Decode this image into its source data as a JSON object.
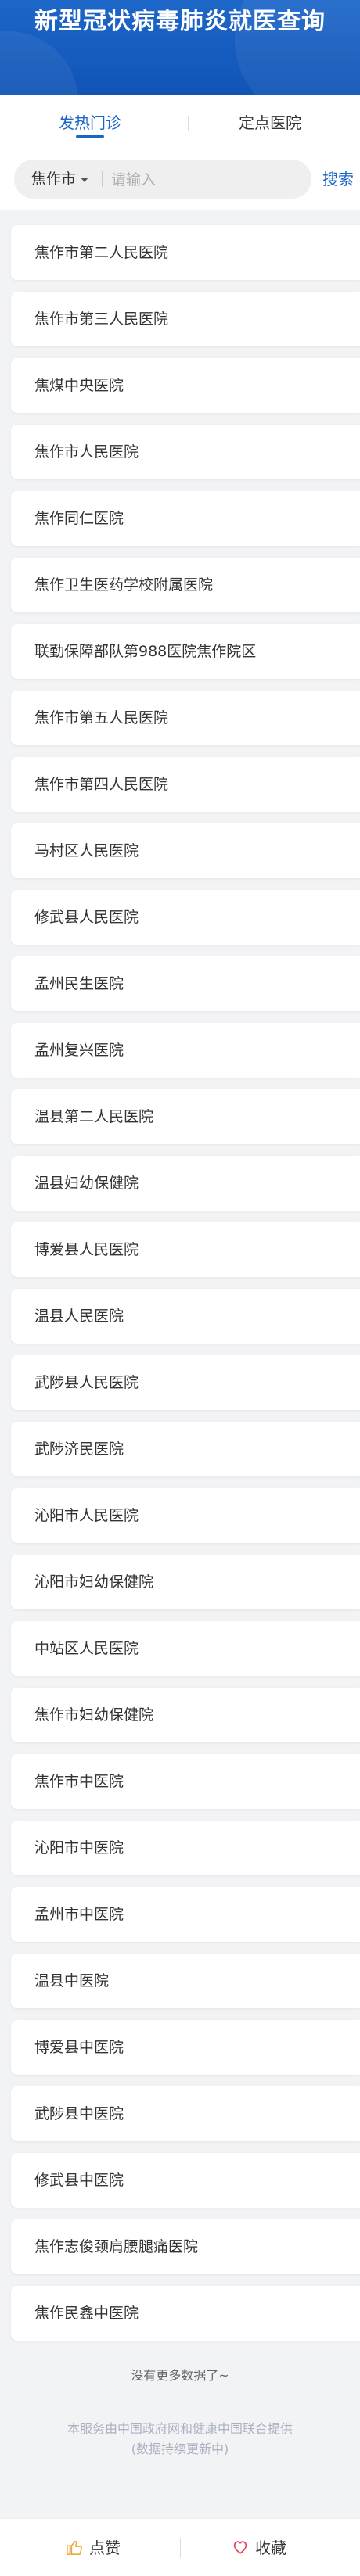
{
  "header": {
    "title": "新型冠状病毒肺炎就医查询"
  },
  "tabs": [
    {
      "label": "发热门诊",
      "active": true
    },
    {
      "label": "定点医院",
      "active": false
    }
  ],
  "search": {
    "city": "焦作市",
    "placeholder": "请输入",
    "value": "",
    "button_label": "搜索"
  },
  "hospitals": [
    "焦作市第二人民医院",
    "焦作市第三人民医院",
    "焦煤中央医院",
    "焦作市人民医院",
    "焦作同仁医院",
    "焦作卫生医药学校附属医院",
    "联勤保障部队第988医院焦作院区",
    "焦作市第五人民医院",
    "焦作市第四人民医院",
    "马村区人民医院",
    "修武县人民医院",
    "孟州民生医院",
    "孟州复兴医院",
    "温县第二人民医院",
    "温县妇幼保健院",
    "博爱县人民医院",
    "温县人民医院",
    "武陟县人民医院",
    "武陟济民医院",
    "沁阳市人民医院",
    "沁阳市妇幼保健院",
    "中站区人民医院",
    "焦作市妇幼保健院",
    "焦作市中医院",
    "沁阳市中医院",
    "孟州市中医院",
    "温县中医院",
    "博爱县中医院",
    "武陟县中医院",
    "修武县中医院",
    "焦作志俊颈肩腰腿痛医院",
    "焦作民鑫中医院"
  ],
  "footer": {
    "no_more": "没有更多数据了~",
    "notice_line1": "本服务由中国政府网和健康中国联合提供",
    "notice_line2": "(数据持续更新中)"
  },
  "bottom_bar": {
    "like_label": "点赞",
    "favorite_label": "收藏",
    "like_icon": "thumbs-up-icon",
    "favorite_icon": "heart-icon"
  },
  "colors": {
    "brand_blue": "#1a66c9",
    "like_icon": "#f0a63a",
    "favorite_icon": "#e0435a"
  }
}
